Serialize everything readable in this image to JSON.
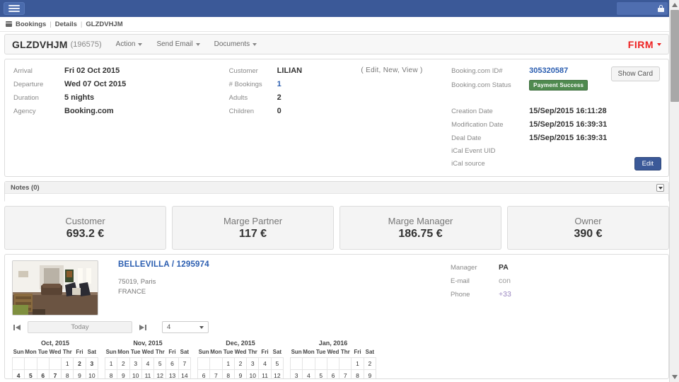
{
  "topbar": {
    "menu_icon": "hamburger-icon",
    "lock_icon": "lock-icon"
  },
  "breadcrumb": {
    "icon": "calendar-icon",
    "items": [
      "Bookings",
      "Details",
      "GLZDVHJM"
    ],
    "separator": "|"
  },
  "title_panel": {
    "code": "GLZDVHJM",
    "id": "(196575)",
    "menus": [
      {
        "label": "Action"
      },
      {
        "label": "Send Email"
      },
      {
        "label": "Documents"
      }
    ],
    "status": "FIRM"
  },
  "details": {
    "left": [
      {
        "label": "Arrival",
        "value": "Fri 02 Oct 2015"
      },
      {
        "label": "Departure",
        "value": "Wed 07 Oct 2015"
      },
      {
        "label": "Duration",
        "value": "5 nights"
      },
      {
        "label": "Agency",
        "value": "Booking.com"
      }
    ],
    "middle": [
      {
        "label": "Customer",
        "value": "LILIAN",
        "link": false
      },
      {
        "label": "# Bookings",
        "value": "1",
        "link": true
      },
      {
        "label": "Adults",
        "value": "2",
        "link": false
      },
      {
        "label": "Children",
        "value": "0",
        "link": false
      }
    ],
    "customer_actions": "( Edit,  New,  View )",
    "right": [
      {
        "label": "Booking.com ID#",
        "value": "305320587"
      },
      {
        "label": "Booking.com Status",
        "value": "Payment Success"
      },
      {
        "label": "Creation Date",
        "value": "15/Sep/2015 16:11:28"
      },
      {
        "label": "Modification Date",
        "value": "15/Sep/2015 16:39:31"
      },
      {
        "label": "Deal Date",
        "value": "15/Sep/2015 16:39:31"
      },
      {
        "label": "iCal Event UID",
        "value": ""
      },
      {
        "label": "iCal source",
        "value": ""
      }
    ],
    "show_card_label": "Show Card",
    "edit_label": "Edit"
  },
  "notes": {
    "title": "Notes (0)"
  },
  "kpis": [
    {
      "label": "Customer",
      "value": "693.2 €"
    },
    {
      "label": "Marge Partner",
      "value": "117 €"
    },
    {
      "label": "Marge Manager",
      "value": "186.75 €"
    },
    {
      "label": "Owner",
      "value": "390 €"
    }
  ],
  "property": {
    "title": "BELLEVILLA / 1295974",
    "address_line1": "75019, Paris",
    "address_line2": "FRANCE",
    "contact": [
      {
        "label": "Manager",
        "value": "PA"
      },
      {
        "label": "E-mail",
        "value": "con"
      },
      {
        "label": "Phone",
        "value": "+33"
      }
    ]
  },
  "calendar_controls": {
    "prev_icon": "skip-previous-icon",
    "today_label": "Today",
    "next_icon": "skip-next-icon",
    "month_count": "4"
  },
  "calendar": {
    "weekday_headers": [
      "Sun",
      "Mon",
      "Tue",
      "Wed",
      "Thr",
      "Fri",
      "Sat"
    ],
    "booked_color": "#ee1111",
    "pad_color": "#b5b5b5",
    "months": [
      {
        "title": "Oct, 2015",
        "lead_blanks": 4,
        "weeks": [
          [
            null,
            null,
            null,
            null,
            "1",
            "2",
            "3"
          ],
          [
            "4",
            "5",
            "6",
            "7",
            "8",
            "9",
            "10"
          ]
        ],
        "booked": [
          "3",
          "4",
          "5",
          "6"
        ],
        "start": "2",
        "end": "7"
      },
      {
        "title": "Nov, 2015",
        "lead_blanks": 0,
        "weeks": [
          [
            "1",
            "2",
            "3",
            "4",
            "5",
            "6",
            "7"
          ],
          [
            "8",
            "9",
            "10",
            "11",
            "12",
            "13",
            "14"
          ]
        ],
        "booked": [],
        "start": null,
        "end": null
      },
      {
        "title": "Dec, 2015",
        "lead_blanks": 2,
        "weeks": [
          [
            null,
            null,
            "1",
            "2",
            "3",
            "4",
            "5"
          ],
          [
            "6",
            "7",
            "8",
            "9",
            "10",
            "11",
            "12"
          ]
        ],
        "booked": [],
        "start": null,
        "end": null
      },
      {
        "title": "Jan, 2016",
        "lead_blanks": 5,
        "weeks": [
          [
            null,
            null,
            null,
            null,
            null,
            "1",
            "2"
          ],
          [
            "3",
            "4",
            "5",
            "6",
            "7",
            "8",
            "9"
          ]
        ],
        "booked": [],
        "start": null,
        "end": null
      }
    ]
  },
  "scrollbar": {
    "up_icon": "scroll-up-icon",
    "down_icon": "scroll-down-icon"
  }
}
